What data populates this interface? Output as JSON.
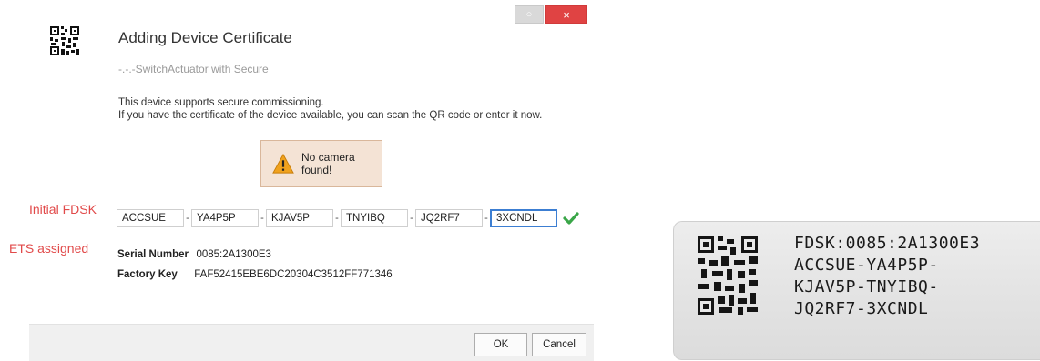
{
  "annotations": {
    "initial_fdsk": "Initial FDSK",
    "ets_assigned": "ETS  assigned"
  },
  "window": {
    "option_button": "○",
    "close_button": "×"
  },
  "dialog": {
    "title": "Adding Device Certificate",
    "subtitle": "-.-.-SwitchActuator with Secure",
    "description_line1": "This device supports secure commissioning.",
    "description_line2": "If you have the certificate of the device available, you can scan the QR code or enter it now.",
    "alert": {
      "icon": "warning-icon",
      "text": "No camera found!"
    },
    "fdsk_segments": [
      "ACCSUE",
      "YA4P5P",
      "KJAV5P",
      "TNYIBQ",
      "JQ2RF7",
      "3XCNDL"
    ],
    "separator": "-",
    "valid_icon": "checkmark-icon",
    "serial_number_label": "Serial Number",
    "serial_number_value": "0085:2A1300E3",
    "factory_key_label": "Factory Key",
    "factory_key_value": "FAF52415EBE6DC20304C3512FF771346",
    "ok_label": "OK",
    "cancel_label": "Cancel"
  },
  "device_label": {
    "lines": [
      "FDSK:0085:2A1300E3",
      "ACCSUE-YA4P5P-",
      "KJAV5P-TNYIBQ-",
      "JQ2RF7-3XCNDL"
    ]
  },
  "colors": {
    "annotation": "#e14a4a",
    "close_button": "#e04343",
    "focus_border": "#3c7ed2",
    "check": "#3aa648",
    "alert_bg": "#f4e3d5"
  }
}
